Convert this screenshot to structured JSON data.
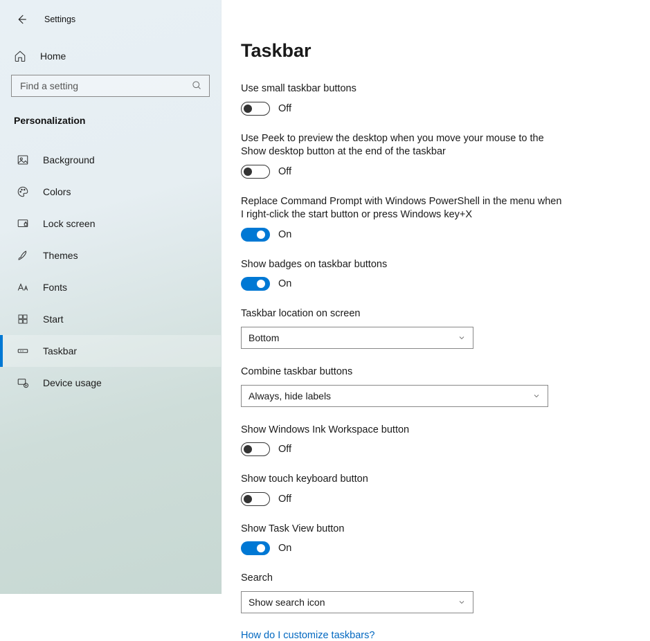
{
  "app_title": "Settings",
  "home_label": "Home",
  "search_placeholder": "Find a setting",
  "category_label": "Personalization",
  "nav": [
    {
      "label": "Background"
    },
    {
      "label": "Colors"
    },
    {
      "label": "Lock screen"
    },
    {
      "label": "Themes"
    },
    {
      "label": "Fonts"
    },
    {
      "label": "Start"
    },
    {
      "label": "Taskbar"
    },
    {
      "label": "Device usage"
    }
  ],
  "page_title": "Taskbar",
  "toggle_on_label": "On",
  "toggle_off_label": "Off",
  "s1": {
    "label": "Use small taskbar buttons",
    "on": false
  },
  "s2": {
    "label": "Use Peek to preview the desktop when you move your mouse to the Show desktop button at the end of the taskbar",
    "on": false
  },
  "s3": {
    "label": "Replace Command Prompt with Windows PowerShell in the menu when I right-click the start button or press Windows key+X",
    "on": true
  },
  "s4": {
    "label": "Show badges on taskbar buttons",
    "on": true
  },
  "d1": {
    "label": "Taskbar location on screen",
    "value": "Bottom"
  },
  "d2": {
    "label": "Combine taskbar buttons",
    "value": "Always, hide labels"
  },
  "s5": {
    "label": "Show Windows Ink Workspace button",
    "on": false
  },
  "s6": {
    "label": "Show touch keyboard button",
    "on": false
  },
  "s7": {
    "label": "Show Task View button",
    "on": true
  },
  "d3": {
    "label": "Search",
    "value": "Show search icon"
  },
  "help_link": "How do I customize taskbars?"
}
